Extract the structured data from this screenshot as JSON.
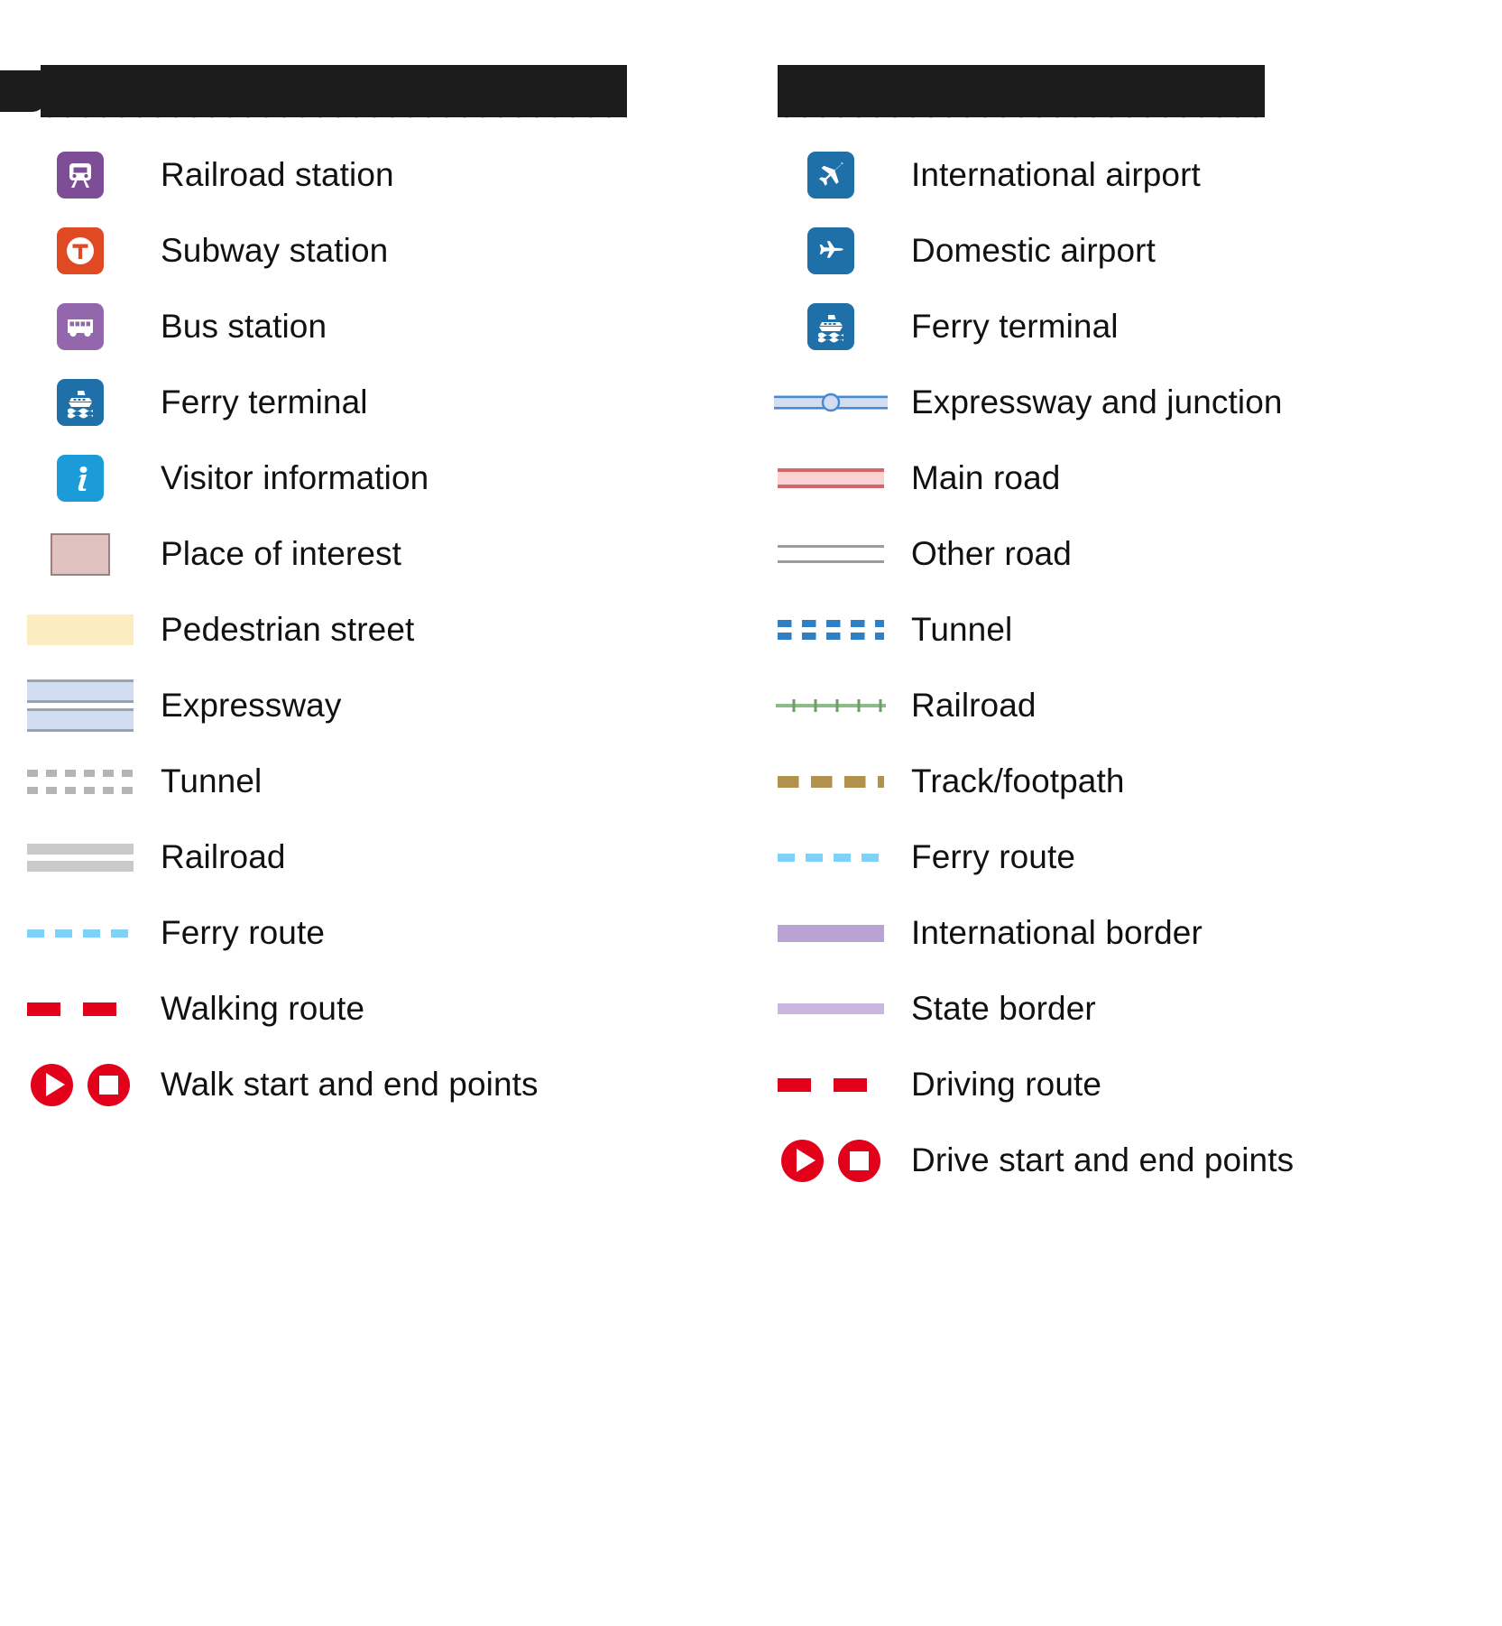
{
  "document": {
    "kind": "map-legend",
    "redacted_titles": [
      "obscured-title-left",
      "obscured-title-right"
    ]
  },
  "colors": {
    "rail_purple": "#7d4e96",
    "bus_purple": "#9467ad",
    "subway_orange": "#e04a22",
    "ferry_blue": "#1f6fa8",
    "info_blue": "#1b9bd8",
    "poi_fill": "#e0c3c1",
    "poi_stroke": "#9b7f7c",
    "pedestrian_yellow": "#fcecc2",
    "expressway_fill": "#d3ddf2",
    "expressway_stroke": "#9ba3b0",
    "expressway_blue_stroke": "#4a89d0",
    "tunnel_gray": "#b5b5b5",
    "railroad_gray": "#c9c9c9",
    "ferry_route_blue": "#7ed2f7",
    "route_red": "#e2001a",
    "main_road_fill": "#f9d3d3",
    "main_road_stroke": "#d4676a",
    "other_road_stroke": "#9c9c9c",
    "tunnel_blue": "#2f7fc4",
    "railroad_green": "#8fbb8a",
    "track_brown": "#b2914f",
    "intl_border_purple": "#b8a3d4",
    "state_border_purple": "#c9b7e0"
  },
  "left_column": {
    "items": [
      {
        "symbol": "railroad-station-icon",
        "label": "Railroad station"
      },
      {
        "symbol": "subway-station-icon",
        "label": "Subway station"
      },
      {
        "symbol": "bus-station-icon",
        "label": "Bus station"
      },
      {
        "symbol": "ferry-terminal-icon",
        "label": "Ferry terminal"
      },
      {
        "symbol": "visitor-information-icon",
        "label": "Visitor information"
      },
      {
        "symbol": "place-of-interest-patch",
        "label": "Place of interest"
      },
      {
        "symbol": "pedestrian-street-patch",
        "label": "Pedestrian street"
      },
      {
        "symbol": "expressway-band",
        "label": "Expressway"
      },
      {
        "symbol": "tunnel-dashed-gray",
        "label": "Tunnel"
      },
      {
        "symbol": "railroad-gray-bars",
        "label": "Railroad"
      },
      {
        "symbol": "ferry-route-dashed",
        "label": "Ferry route"
      },
      {
        "symbol": "walking-route-dashed",
        "label": "Walking route"
      },
      {
        "symbol": "walk-start-end-markers",
        "label": "Walk start and end points"
      }
    ]
  },
  "right_column": {
    "items": [
      {
        "symbol": "international-airport-icon",
        "label": "International airport"
      },
      {
        "symbol": "domestic-airport-icon",
        "label": "Domestic airport"
      },
      {
        "symbol": "ferry-terminal-icon",
        "label": "Ferry terminal"
      },
      {
        "symbol": "expressway-junction-line",
        "label": "Expressway and junction"
      },
      {
        "symbol": "main-road-band",
        "label": "Main road"
      },
      {
        "symbol": "other-road-band",
        "label": "Other road"
      },
      {
        "symbol": "tunnel-dashed-blue",
        "label": "Tunnel"
      },
      {
        "symbol": "railroad-green-ticks",
        "label": "Railroad"
      },
      {
        "symbol": "track-footpath-dashed",
        "label": "Track/footpath"
      },
      {
        "symbol": "ferry-route-dashed",
        "label": "Ferry route"
      },
      {
        "symbol": "international-border-band",
        "label": "International border"
      },
      {
        "symbol": "state-border-band",
        "label": "State border"
      },
      {
        "symbol": "driving-route-dashed",
        "label": "Driving route"
      },
      {
        "symbol": "drive-start-end-markers",
        "label": "Drive start and end points"
      }
    ]
  }
}
